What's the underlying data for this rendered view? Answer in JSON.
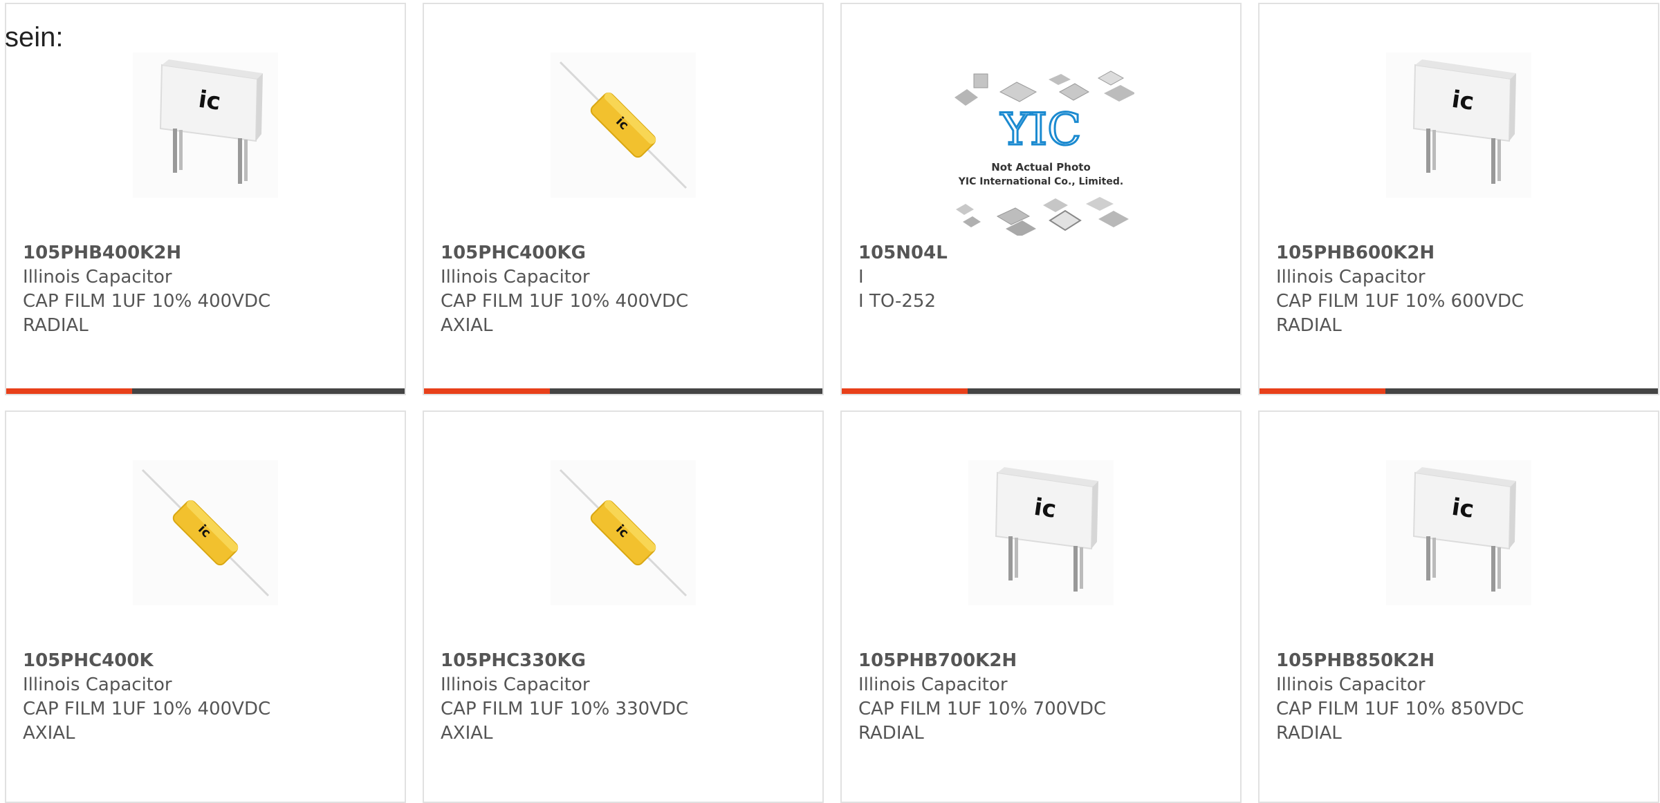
{
  "lead_text": "sein:",
  "colors": {
    "accent": "#e8401a",
    "bar": "#444444",
    "border": "#e1e1e1"
  },
  "products": [
    {
      "part": "105PHB400K2H",
      "mfr": "Illinois Capacitor",
      "desc1": "CAP FILM 1UF 10% 400VDC",
      "desc2": "RADIAL",
      "image": "radial-capacitor-photo"
    },
    {
      "part": "105PHC400KG",
      "mfr": "Illinois Capacitor",
      "desc1": "CAP FILM 1UF 10% 400VDC",
      "desc2": "AXIAL",
      "image": "axial-capacitor-photo"
    },
    {
      "part": "105N04L",
      "mfr": "I",
      "desc1": "I TO-252",
      "desc2": "",
      "image": "not-actual-photo-placeholder",
      "placeholder_line1": "Not Actual Photo",
      "placeholder_line2": "YIC International Co., Limited.",
      "placeholder_logo": "YIC"
    },
    {
      "part": "105PHB600K2H",
      "mfr": "Illinois Capacitor",
      "desc1": "CAP FILM 1UF 10% 600VDC",
      "desc2": "RADIAL",
      "image": "radial-capacitor-photo"
    },
    {
      "part": "105PHC400K",
      "mfr": "Illinois Capacitor",
      "desc1": "CAP FILM 1UF 10% 400VDC",
      "desc2": "AXIAL",
      "image": "axial-capacitor-photo"
    },
    {
      "part": "105PHC330KG",
      "mfr": "Illinois Capacitor",
      "desc1": "CAP FILM 1UF 10% 330VDC",
      "desc2": "AXIAL",
      "image": "axial-capacitor-photo"
    },
    {
      "part": "105PHB700K2H",
      "mfr": "Illinois Capacitor",
      "desc1": "CAP FILM 1UF 10% 700VDC",
      "desc2": "RADIAL",
      "image": "radial-capacitor-photo"
    },
    {
      "part": "105PHB850K2H",
      "mfr": "Illinois Capacitor",
      "desc1": "CAP FILM 1UF 10% 850VDC",
      "desc2": "RADIAL",
      "image": "radial-capacitor-photo"
    }
  ]
}
